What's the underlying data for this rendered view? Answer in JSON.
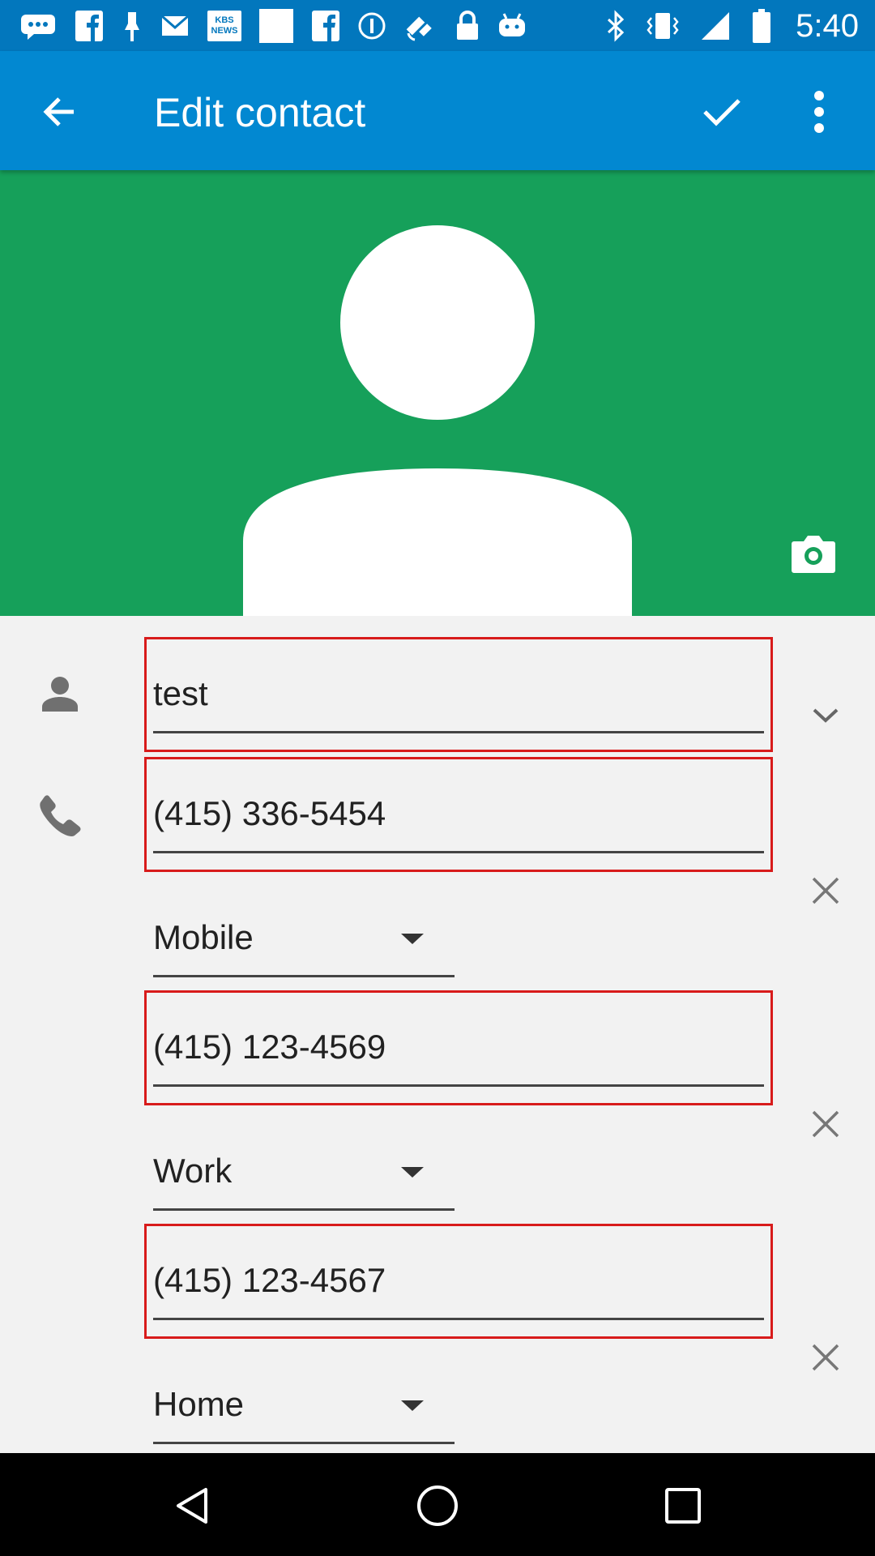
{
  "status_bar": {
    "time": "5:40",
    "left_icons": [
      "chat-bubble-icon",
      "facebook-icon",
      "clip-icon",
      "mail-icon",
      "kbs-news-icon",
      "blank-square-icon",
      "facebook-icon",
      "info-icon",
      "fake-gps-icon",
      "lock-icon",
      "android-icon"
    ],
    "news_badge_text": "KBS NEWS",
    "right_icons": [
      "bluetooth-icon",
      "vibrate-icon",
      "signal-icon",
      "battery-icon"
    ]
  },
  "app_bar": {
    "title": "Edit contact",
    "back_icon": "arrow-back-icon",
    "save_icon": "check-icon",
    "menu_icon": "more-vert-icon",
    "color": "#0288d1"
  },
  "photo": {
    "background": "#16a05a",
    "camera_icon": "camera-icon"
  },
  "form": {
    "name": {
      "value": "test",
      "icon": "person-icon"
    },
    "phones": [
      {
        "number": "(415) 336-5454",
        "type": "Mobile"
      },
      {
        "number": "(415) 123-4569",
        "type": "Work"
      },
      {
        "number": "(415) 123-4567",
        "type": "Home"
      }
    ],
    "phone_icon": "phone-icon",
    "highlight_color": "#d81b1b"
  },
  "nav_bar": {
    "buttons": [
      "back-triangle-icon",
      "home-circle-icon",
      "recents-square-icon"
    ]
  }
}
